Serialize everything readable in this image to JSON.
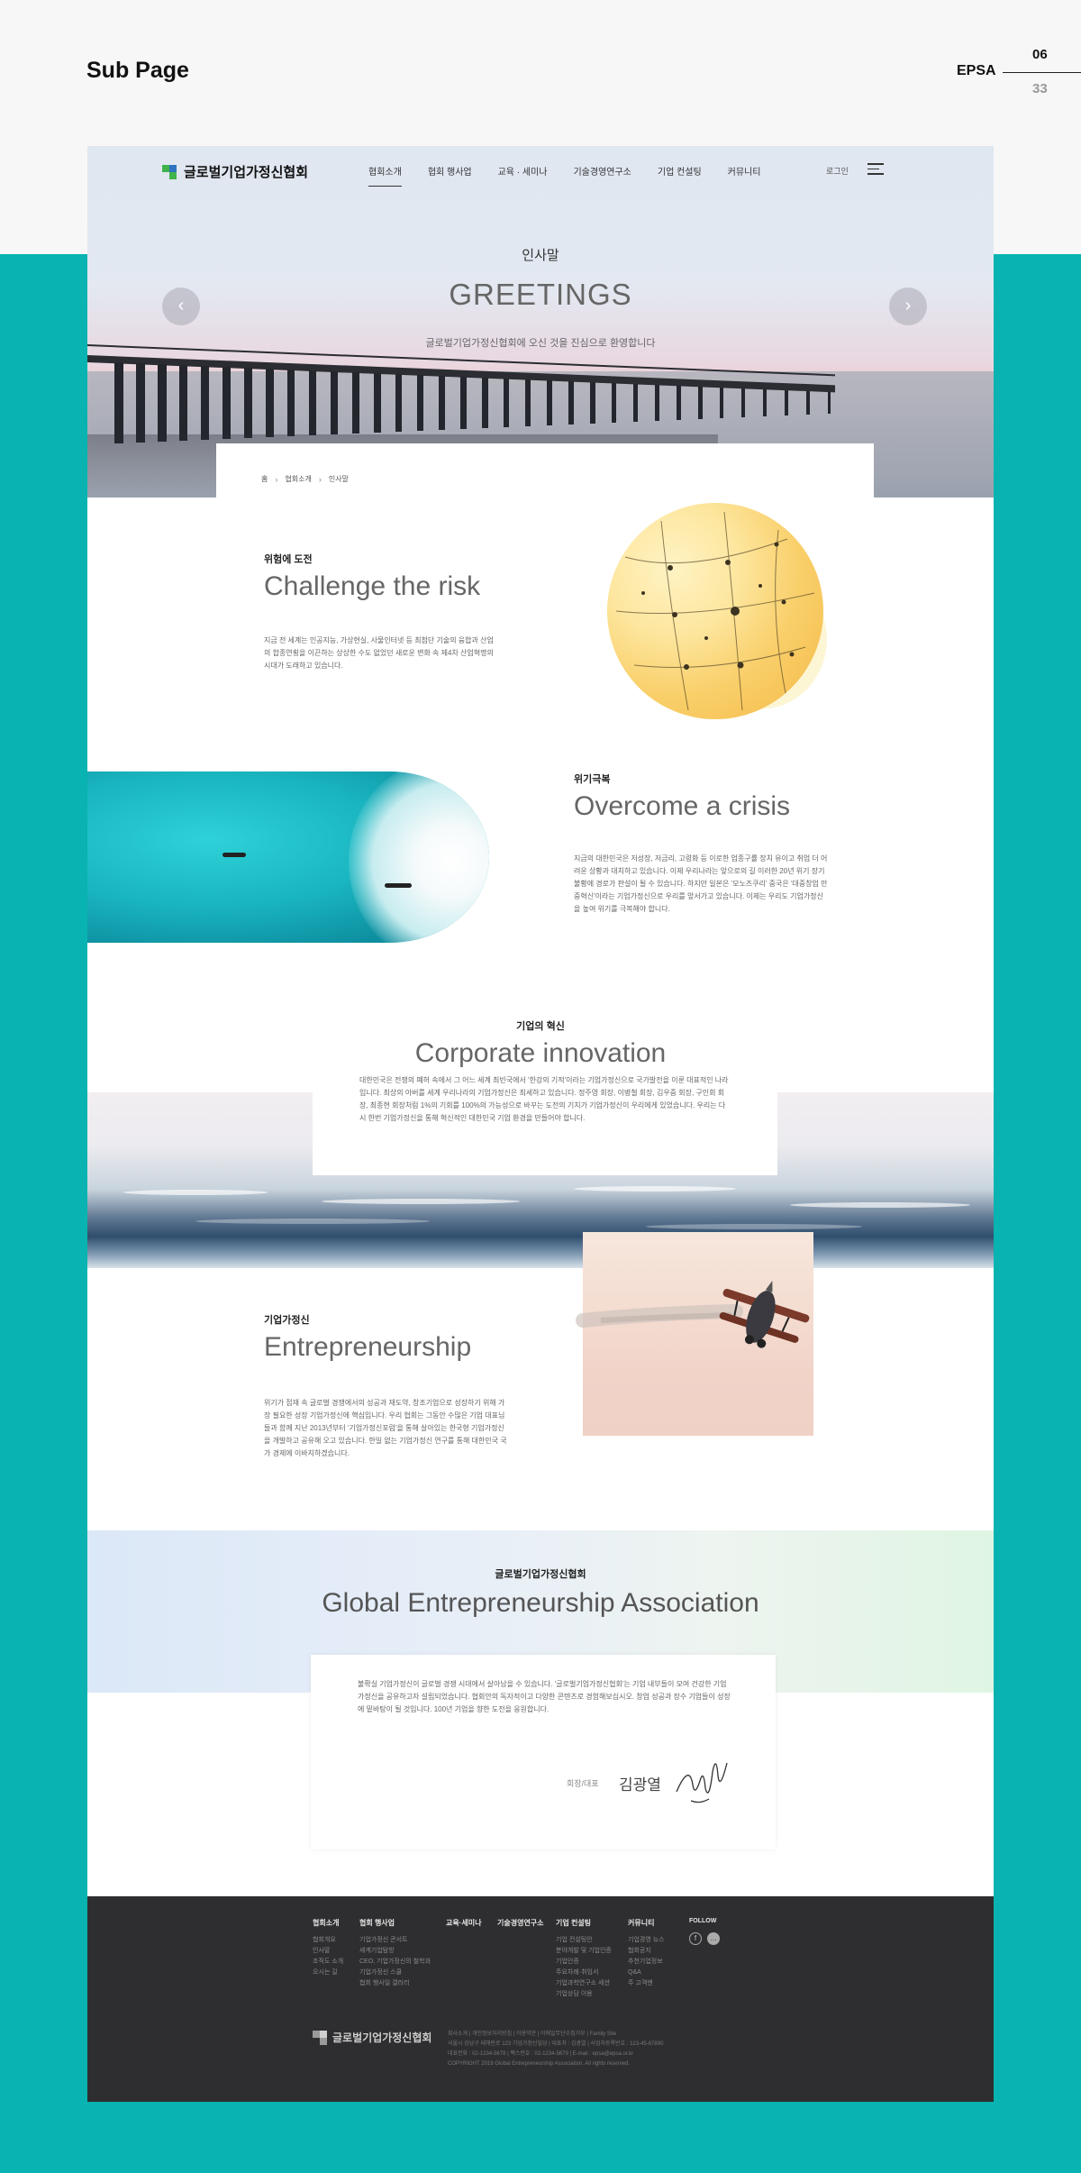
{
  "frame": {
    "title": "Sub Page",
    "brand": "EPSA",
    "page": "06",
    "total": "33"
  },
  "header": {
    "logo_text": "글로벌기업가정신협회",
    "menu": [
      "협회소개",
      "협회 행사업",
      "교육 · 세미나",
      "기술경영연구소",
      "기업 컨설팅",
      "커뮤니티"
    ],
    "login": "로그인"
  },
  "hero": {
    "kicker": "인사말",
    "title": "GREETINGS",
    "subtitle": "글로벌기업가정신협회에 오신 것을 진심으로 환영합니다"
  },
  "breadcrumb": [
    "홈",
    "협회소개",
    "인사말"
  ],
  "sections": {
    "challenge": {
      "kicker": "위험에 도전",
      "title": "Challenge the risk",
      "body": "지금 전 세계는 인공지능, 가상현실, 사물인터넷 등 최첨단 기술의 융합과 산업의 합종연횡을 이끈하는 상상한 수도 없었던 새로운 변화 속 제4차 산업혁명의 시대가 도래하고 있습니다."
    },
    "overcome": {
      "kicker": "위기극복",
      "title": "Overcome a crisis",
      "body": "지금의 대한민국은 저성장, 저금리, 고령화 등 이로한 업종구률 장치 유이고 취업 더 어려운 상황과 대치하고 있습니다. 이제 우리나라는 앞으로의 길 이러한 20년 위기 장기불황에 경로가 판설이 될 수 있습니다. 하지만 일본은 '모노즈쿠리' 중국은 '대중창업 만중혁신'이라는 기업가정신으로 우리를 앞서가고 있습니다. 이제는 우리도 기업가정신을 높여 위기를 극복해야 합니다."
    },
    "innovation": {
      "kicker": "기업의 혁신",
      "title": "Corporate innovation",
      "body": "대한민국은 전쟁의 폐허 속에서 그 어느 세계 최빈국에서 '한강의 기적'이라는 기업가정신으로 국가발전을 이룬 대표적인 나라입니다. 최상의 아버를 세계 우리나라의 기업가정신은 최세하고 있습니다. 정주영 회장, 이병철 회장, 김우중 회장, 구인회 회장, 최종현 회장처럼 1%의 기회를 100%의 가능성으로 바꾸는 도전의 기치가 기업가정신이 우리에게 있었습니다. 우리는 다시 한번 기업가정신을 통해 혁신적인 대한민국 기업 환경을 만들어야 합니다."
    },
    "entrepreneurship": {
      "kicker": "기업가정신",
      "title": "Entrepreneurship",
      "body": "위기가 접재 속 글로벌 경쟁에서의 성공과 재도약, 창조기업으로 성장하기 위해 가장 필요한 성장 기업가정신에 핵심입니다. 우리 협회는 그동안 수많은 기업 대표님들과 함께 지난 2013년부터 '기업가정신포럼'을 통해 살아있는 한국형 기업가정신을 개발하고 공유해 오고 있습니다. 한일 없는 기업가정신 연구를 통해 대한민국 국가 경제에 이바지하겠습니다."
    },
    "global": {
      "kicker": "글로벌기업가정신협회",
      "title": "Global Entrepreneurship Association",
      "body": "불확실 기업가정신이 글로벌 경쟁 시대에서 살아남을 수 있습니다. '글로벌기업가정신협회'는 기업 내부들이 모여 건강한 기업가정신을 공유하고자 설립되었습니다. 협회안의 독자적이고 다양한 콘텐츠로 경험해보십시오. 창업 성공과 장수 기업들이 성장에 밑바탕이 될 것입니다. 100년 기업을 향한 도전을 응원합니다.",
      "signature_label": "회장/대표",
      "signature_name": "김광열"
    }
  },
  "footer": {
    "columns": [
      {
        "head": "협회소개",
        "links": [
          "협회개요",
          "인사말",
          "조직도 소개",
          "오시는 길"
        ]
      },
      {
        "head": "협회 행사업",
        "links": [
          "기업가정신 콘서트",
          "세계기업탐방",
          "CEO, 기업가정신의 철학과",
          "기업가정신 스쿨",
          "협회 행사일 갤러리"
        ]
      },
      {
        "head": "교육·세미나",
        "links": []
      },
      {
        "head": "기술경영연구소",
        "links": []
      },
      {
        "head": "기업 컨설팅",
        "links": [
          "기업 컨설팅안",
          "분야개발 및 기업인증",
          "기업인증",
          "주요차례·취임서",
          "기업과학연구소 세션",
          "기업상담 이용"
        ]
      },
      {
        "head": "커뮤니티",
        "links": [
          "기업경영 뉴스",
          "협회공지",
          "추천기업정보",
          "Q&A",
          "주 고객맨"
        ]
      }
    ],
    "follow": "FOLLOW",
    "logo_text": "글로벌기업가정신협회",
    "info_lines": [
      "회사소개 | 개인정보처리방침 | 이용약관 | 이메일무단수집거부 | Family Site",
      "서울시 강남구 테헤란로 123 기업가정신빌딩 | 대표자 : 김광열 | 사업자등록번호 : 123-45-67890",
      "대표전화 : 02-1234-5678 | 팩스번호 : 02-1234-5679 | E-mail : epsa@epsa.or.kr",
      "COPYRIGHT 2019 Global Entrepreneurship Association. All rights reserved."
    ]
  },
  "colors": {
    "teal": "#08b3b1",
    "footer": "#2e2e30",
    "logo_green": "#3fb44b",
    "logo_blue": "#2f74c0"
  }
}
